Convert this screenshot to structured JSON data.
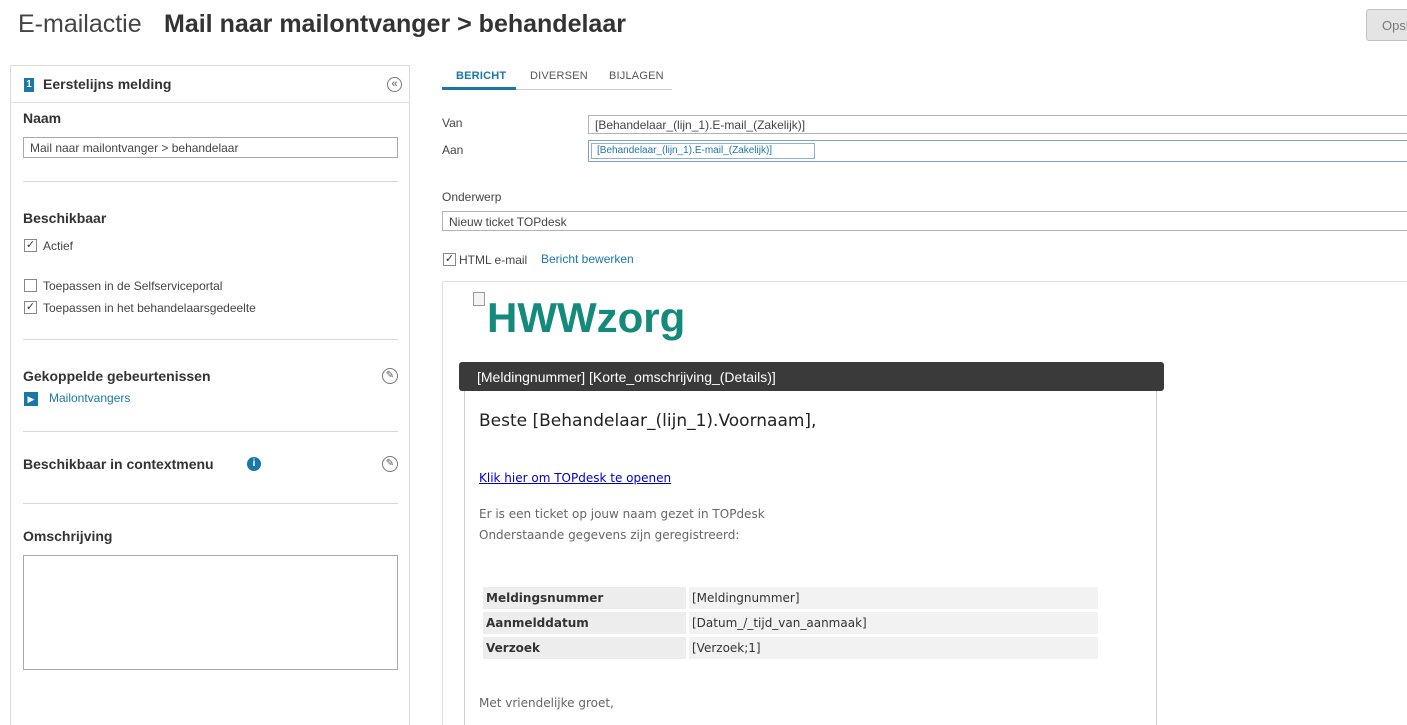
{
  "header": {
    "page_type": "E-mailactie",
    "title": "Mail naar mailontvanger > behandelaar",
    "save_label": "Opslaan"
  },
  "left_panel": {
    "title": "Eerstelijns melding",
    "step_number": "1",
    "name_section": "Naam",
    "name_value": "Mail naar mailontvanger > behandelaar",
    "available_section": "Beschikbaar",
    "checkboxes": [
      {
        "label": "Actief",
        "checked": true
      },
      {
        "label": "Toepassen in de Selfserviceportal",
        "checked": false
      },
      {
        "label": "Toepassen in het behandelaarsgedeelte",
        "checked": true
      }
    ],
    "events_section": "Gekoppelde gebeurtenissen",
    "events_link": "Mailontvangers",
    "context_section": "Beschikbaar in contextmenu",
    "description_section": "Omschrijving",
    "description_value": ""
  },
  "tabs": [
    {
      "label": "BERICHT",
      "active": true
    },
    {
      "label": "DIVERSEN",
      "active": false
    },
    {
      "label": "BIJLAGEN",
      "active": false
    }
  ],
  "form": {
    "from_label": "Van",
    "from_value": "[Behandelaar_(lijn_1).E-mail_(Zakelijk)]",
    "to_label": "Aan",
    "to_token": "[Behandelaar_(lijn_1).E-mail_(Zakelijk)]",
    "subject_label": "Onderwerp",
    "subject_value": "Nieuw ticket TOPdesk",
    "html_label": "HTML e-mail",
    "html_checked": true,
    "edit_link": "Bericht bewerken"
  },
  "preview": {
    "logo_alt": "HWWzorg",
    "header": "[Meldingnummer] [Korte_omschrijving_(Details)]",
    "greeting": "Beste [Behandelaar_(lijn_1).Voornaam],",
    "open_link": "Klik hier om TOPdesk te openen",
    "line1": "Er is een ticket op jouw naam gezet in TOPdesk",
    "line2": "Onderstaande gegevens zijn geregistreerd:",
    "rows": [
      {
        "key": "Meldingsnummer",
        "value": "[Meldingnummer]"
      },
      {
        "key": "Aanmelddatum",
        "value": "[Datum_/_tijd_van_aanmaak]"
      },
      {
        "key": "Verzoek",
        "value": "[Verzoek;1]"
      }
    ],
    "signoff": "Met vriendelijke groet,"
  },
  "colors": {
    "accent": "#1a78a8",
    "logo": "#138a7b",
    "mail_header": "#3a3a3a"
  },
  "icons": [
    "step-number-icon",
    "collapse-icon",
    "play-icon",
    "edit-icon",
    "info-icon",
    "checkbox-icon",
    "broken-image-icon"
  ]
}
